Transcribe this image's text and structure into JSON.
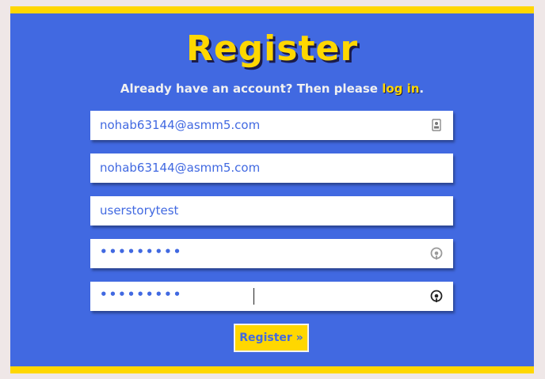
{
  "page": {
    "title": "Register",
    "subtitle_prefix": "Already have an account? Then please ",
    "login_link": "log in",
    "subtitle_suffix": "."
  },
  "form": {
    "email_value": "nohab63144@asmm5.com",
    "email_confirm_value": "nohab63144@asmm5.com",
    "username_value": "userstorytest",
    "password_value": "•••••••••",
    "password_confirm_value": "•••••••••",
    "submit_label": "Register »"
  },
  "icons": {
    "email": "contact-card-icon",
    "password": "reveal-password-icon",
    "password_confirm": "reveal-password-icon"
  },
  "colors": {
    "background": "#4169e1",
    "accent": "#ffd700",
    "page": "#efe7e7",
    "field_text": "#4169e1"
  }
}
